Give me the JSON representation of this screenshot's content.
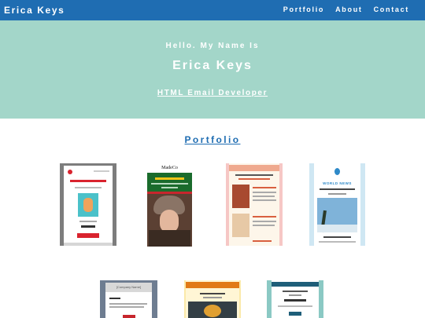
{
  "nav": {
    "brand": "Erica Keys",
    "links": [
      "Portfolio",
      "About",
      "Contact"
    ]
  },
  "hero": {
    "greeting": "Hello. My Name Is",
    "name": "Erica Keys",
    "role": "HTML Email Developer"
  },
  "portfolio": {
    "title": "Portfolio",
    "thumbnails": [
      {
        "logo_text": ""
      },
      {
        "logo_text": "MadeCo"
      },
      {
        "logo_text": ""
      },
      {
        "logo_text": "WORLD NEWS"
      },
      {
        "logo_text": "[Company Name]"
      },
      {
        "logo_text": ""
      },
      {
        "logo_text": ""
      }
    ]
  },
  "colors": {
    "nav_bg": "#1f6db2",
    "hero_bg": "#a3d6c9",
    "accent": "#1f6db2"
  }
}
